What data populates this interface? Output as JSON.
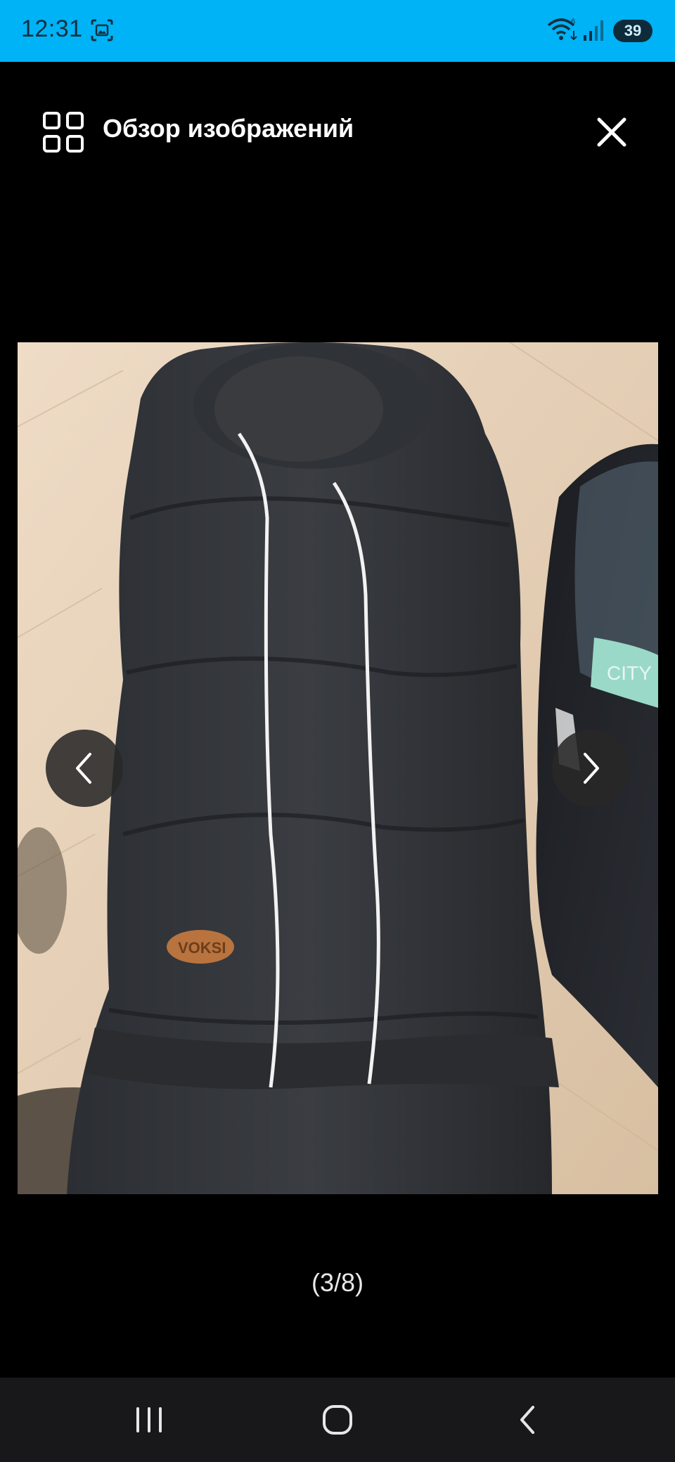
{
  "status_bar": {
    "time": "12:31",
    "battery_level": "39",
    "icons": [
      "screenshot-icon",
      "wifi-icon",
      "signal-icon",
      "battery-icon"
    ],
    "bg_color": "#00B2F6"
  },
  "header": {
    "title": "Обзор изображений",
    "icons": [
      "grid-icon",
      "close-icon"
    ]
  },
  "viewer": {
    "counter": "(3/8)",
    "current_index": 3,
    "total": 8,
    "photo_logo_text": "VOKSI",
    "bag_label_text": "CITY",
    "icons": [
      "chevron-left-icon",
      "chevron-right-icon"
    ]
  },
  "system_nav": {
    "icons": [
      "recents-icon",
      "home-icon",
      "back-icon"
    ]
  }
}
